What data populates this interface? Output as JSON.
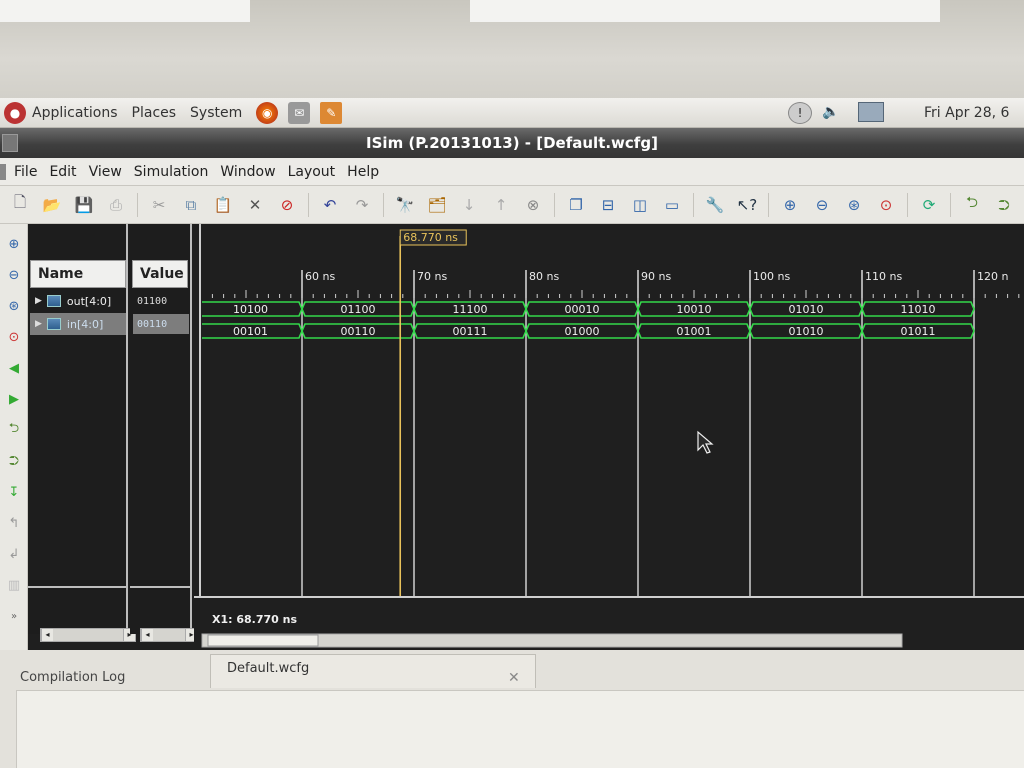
{
  "os_panel": {
    "menus": [
      "Applications",
      "Places",
      "System"
    ],
    "clock": "Fri Apr 28, 6"
  },
  "window": {
    "title": "ISim (P.20131013) - [Default.wcfg]"
  },
  "menubar": {
    "items": [
      "File",
      "Edit",
      "View",
      "Simulation",
      "Window",
      "Layout",
      "Help"
    ]
  },
  "toolbar": {
    "icons": [
      "new-icon",
      "open-icon",
      "save-icon",
      "print-icon",
      "cut-icon",
      "copy-icon",
      "paste-icon",
      "delete-icon",
      "stop-icon",
      "undo-icon",
      "redo-icon",
      "find-icon",
      "find-next-icon",
      "down-arrow-icon",
      "up-arrow-icon",
      "clear-icon",
      "cascade-icon",
      "tile-horizontal-icon",
      "tile-vertical-icon",
      "window-icon",
      "wrench-icon",
      "help-icon",
      "zoom-in-icon",
      "zoom-out-icon",
      "zoom-fit-icon",
      "zoom-cursor-icon",
      "refresh-icon",
      "restart-icon",
      "run-icon"
    ]
  },
  "wave": {
    "headers": {
      "name": "Name",
      "value": "Value"
    },
    "cursor_label": "68.770 ns",
    "cursor_time": 68.77,
    "time_axis": [
      {
        "t": 60,
        "label": "60 ns"
      },
      {
        "t": 70,
        "label": "70 ns"
      },
      {
        "t": 80,
        "label": "80 ns"
      },
      {
        "t": 90,
        "label": "90 ns"
      },
      {
        "t": 100,
        "label": "100 ns"
      },
      {
        "t": 110,
        "label": "110 ns"
      },
      {
        "t": 120,
        "label": "120 n"
      }
    ],
    "signals": [
      {
        "name": "out[4:0]",
        "value": "01100",
        "segments": [
          "10100",
          "01100",
          "11100",
          "00010",
          "10010",
          "01010",
          "11010"
        ]
      },
      {
        "name": "in[4:0]",
        "value": "00110",
        "segments": [
          "00101",
          "00110",
          "00111",
          "01000",
          "01001",
          "01010",
          "01011"
        ]
      }
    ],
    "x1_readout": "X1: 68.770 ns"
  },
  "tabs": {
    "default_tab": "Default.wcfg",
    "compilation_log": "Compilation Log"
  },
  "colors": {
    "wave_green": "#33d94a",
    "cursor_yellow": "#e8c25a",
    "wave_bg": "#1f1f1f"
  }
}
